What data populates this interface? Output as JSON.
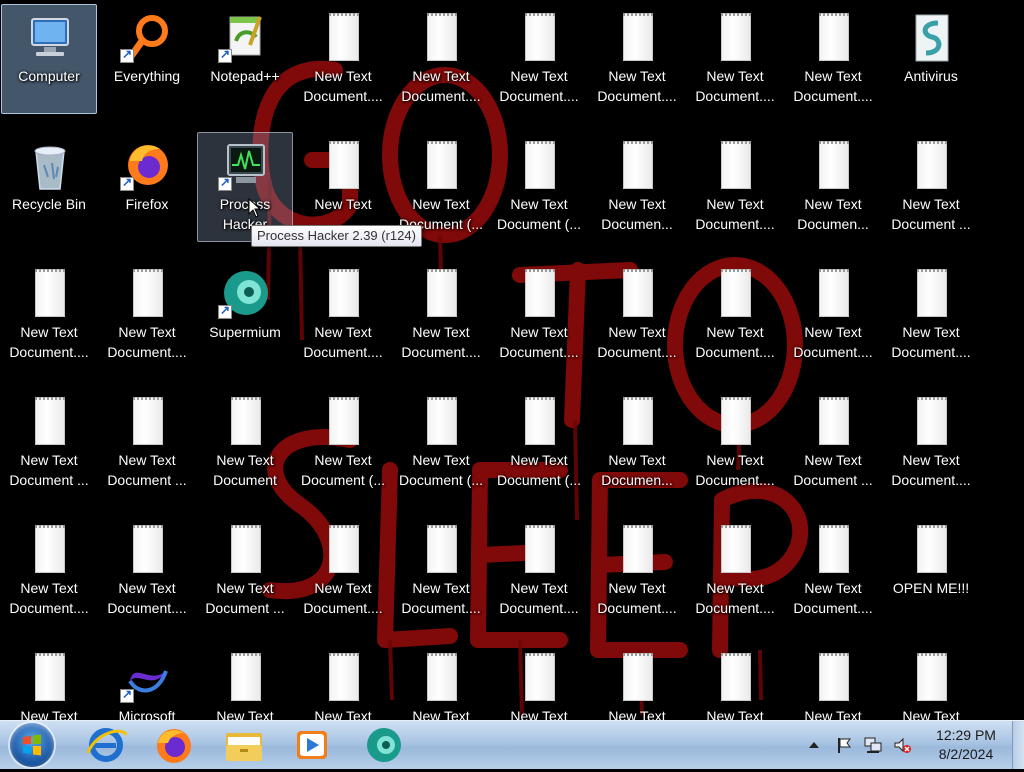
{
  "desktop": {
    "icons": [
      {
        "name": "Computer",
        "kind": "computer",
        "col": 0,
        "row": 0,
        "state": "selected"
      },
      {
        "name": "Everything",
        "kind": "everything",
        "col": 1,
        "row": 0,
        "shortcut": true
      },
      {
        "name": "Notepad++",
        "kind": "notepad",
        "col": 2,
        "row": 0,
        "shortcut": true
      },
      {
        "name": "New Text Document....",
        "kind": "doc",
        "col": 3,
        "row": 0
      },
      {
        "name": "New Text Document....",
        "kind": "doc",
        "col": 4,
        "row": 0
      },
      {
        "name": "New Text Document....",
        "kind": "doc",
        "col": 5,
        "row": 0
      },
      {
        "name": "New Text Document....",
        "kind": "doc",
        "col": 6,
        "row": 0
      },
      {
        "name": "New Text Document....",
        "kind": "doc",
        "col": 7,
        "row": 0
      },
      {
        "name": "New Text Document....",
        "kind": "doc",
        "col": 8,
        "row": 0
      },
      {
        "name": "Antivirus",
        "kind": "antivirus",
        "col": 9,
        "row": 0
      },
      {
        "name": "Recycle Bin",
        "kind": "recycle",
        "col": 0,
        "row": 1
      },
      {
        "name": "Firefox",
        "kind": "firefox",
        "col": 1,
        "row": 1,
        "shortcut": true
      },
      {
        "name": "Process Hacker",
        "kind": "prochacker",
        "col": 2,
        "row": 1,
        "shortcut": true,
        "state": "hover"
      },
      {
        "name": "New Text",
        "kind": "doc",
        "col": 3,
        "row": 1
      },
      {
        "name": "New Text Document (...",
        "kind": "doc",
        "col": 4,
        "row": 1
      },
      {
        "name": "New Text Document (...",
        "kind": "doc",
        "col": 5,
        "row": 1
      },
      {
        "name": "New Text Documen...",
        "kind": "doc",
        "col": 6,
        "row": 1
      },
      {
        "name": "New Text Document....",
        "kind": "doc",
        "col": 7,
        "row": 1
      },
      {
        "name": "New Text Documen...",
        "kind": "doc",
        "col": 8,
        "row": 1
      },
      {
        "name": "New Text Document ...",
        "kind": "doc",
        "col": 9,
        "row": 1
      },
      {
        "name": "New Text Document....",
        "kind": "doc",
        "col": 0,
        "row": 2
      },
      {
        "name": "New Text Document....",
        "kind": "doc",
        "col": 1,
        "row": 2
      },
      {
        "name": "Supermium",
        "kind": "supermium",
        "col": 2,
        "row": 2,
        "shortcut": true
      },
      {
        "name": "New Text Document....",
        "kind": "doc",
        "col": 3,
        "row": 2
      },
      {
        "name": "New Text Document....",
        "kind": "doc",
        "col": 4,
        "row": 2
      },
      {
        "name": "New Text Document....",
        "kind": "doc",
        "col": 5,
        "row": 2
      },
      {
        "name": "New Text Document....",
        "kind": "doc",
        "col": 6,
        "row": 2
      },
      {
        "name": "New Text Document....",
        "kind": "doc",
        "col": 7,
        "row": 2
      },
      {
        "name": "New Text Document....",
        "kind": "doc",
        "col": 8,
        "row": 2
      },
      {
        "name": "New Text Document....",
        "kind": "doc",
        "col": 9,
        "row": 2
      },
      {
        "name": "New Text Document ...",
        "kind": "doc",
        "col": 0,
        "row": 3
      },
      {
        "name": "New Text Document ...",
        "kind": "doc",
        "col": 1,
        "row": 3
      },
      {
        "name": "New Text Document",
        "kind": "doc",
        "col": 2,
        "row": 3
      },
      {
        "name": "New Text Document (...",
        "kind": "doc",
        "col": 3,
        "row": 3
      },
      {
        "name": "New Text Document (...",
        "kind": "doc",
        "col": 4,
        "row": 3
      },
      {
        "name": "New Text Document (...",
        "kind": "doc",
        "col": 5,
        "row": 3
      },
      {
        "name": "New Text Documen...",
        "kind": "doc",
        "col": 6,
        "row": 3
      },
      {
        "name": "New Text Document....",
        "kind": "doc",
        "col": 7,
        "row": 3
      },
      {
        "name": "New Text Document ...",
        "kind": "doc",
        "col": 8,
        "row": 3
      },
      {
        "name": "New Text Document....",
        "kind": "doc",
        "col": 9,
        "row": 3
      },
      {
        "name": "New Text Document....",
        "kind": "doc",
        "col": 0,
        "row": 4
      },
      {
        "name": "New Text Document....",
        "kind": "doc",
        "col": 1,
        "row": 4
      },
      {
        "name": "New Text Document ...",
        "kind": "doc",
        "col": 2,
        "row": 4
      },
      {
        "name": "New Text Document....",
        "kind": "doc",
        "col": 3,
        "row": 4
      },
      {
        "name": "New Text Document....",
        "kind": "doc",
        "col": 4,
        "row": 4
      },
      {
        "name": "New Text Document....",
        "kind": "doc",
        "col": 5,
        "row": 4
      },
      {
        "name": "New Text Document....",
        "kind": "doc",
        "col": 6,
        "row": 4
      },
      {
        "name": "New Text Document....",
        "kind": "doc",
        "col": 7,
        "row": 4
      },
      {
        "name": "New Text Document....",
        "kind": "doc",
        "col": 8,
        "row": 4
      },
      {
        "name": "OPEN ME!!!",
        "kind": "doc",
        "col": 9,
        "row": 4
      },
      {
        "name": "New Text",
        "kind": "doc",
        "col": 0,
        "row": 5
      },
      {
        "name": "Microsoft",
        "kind": "vs",
        "col": 1,
        "row": 5,
        "shortcut": true
      },
      {
        "name": "New Text",
        "kind": "doc",
        "col": 2,
        "row": 5
      },
      {
        "name": "New Text",
        "kind": "doc",
        "col": 3,
        "row": 5
      },
      {
        "name": "New Text",
        "kind": "doc",
        "col": 4,
        "row": 5
      },
      {
        "name": "New Text",
        "kind": "doc",
        "col": 5,
        "row": 5
      },
      {
        "name": "New Text",
        "kind": "doc",
        "col": 6,
        "row": 5
      },
      {
        "name": "New Text",
        "kind": "doc",
        "col": 7,
        "row": 5
      },
      {
        "name": "New Text",
        "kind": "doc",
        "col": 8,
        "row": 5
      },
      {
        "name": "New Text",
        "kind": "doc",
        "col": 9,
        "row": 5
      }
    ],
    "tooltip": "Process Hacker 2.39 (r124)"
  },
  "taskbar": {
    "start": {
      "icon": "windows-start-orb"
    },
    "pinned": [
      {
        "name": "Internet Explorer",
        "icon": "internet-explorer-icon"
      },
      {
        "name": "Firefox",
        "icon": "firefox-icon"
      },
      {
        "name": "Windows Explorer",
        "icon": "folder-icon"
      },
      {
        "name": "Windows Media Player",
        "icon": "media-player-icon"
      },
      {
        "name": "Supermium",
        "icon": "supermium-icon"
      }
    ],
    "tray": {
      "icons": [
        "show-hidden-icons-arrow",
        "action-center-flag-icon",
        "network-icon",
        "volume-muted-icon"
      ],
      "time": "12:29 PM",
      "date": "8/2/2024"
    }
  },
  "colors": {
    "wallpaper_text": "#8b0a0a",
    "taskbar": "#a9c4e3",
    "selection": "#96bee8"
  }
}
